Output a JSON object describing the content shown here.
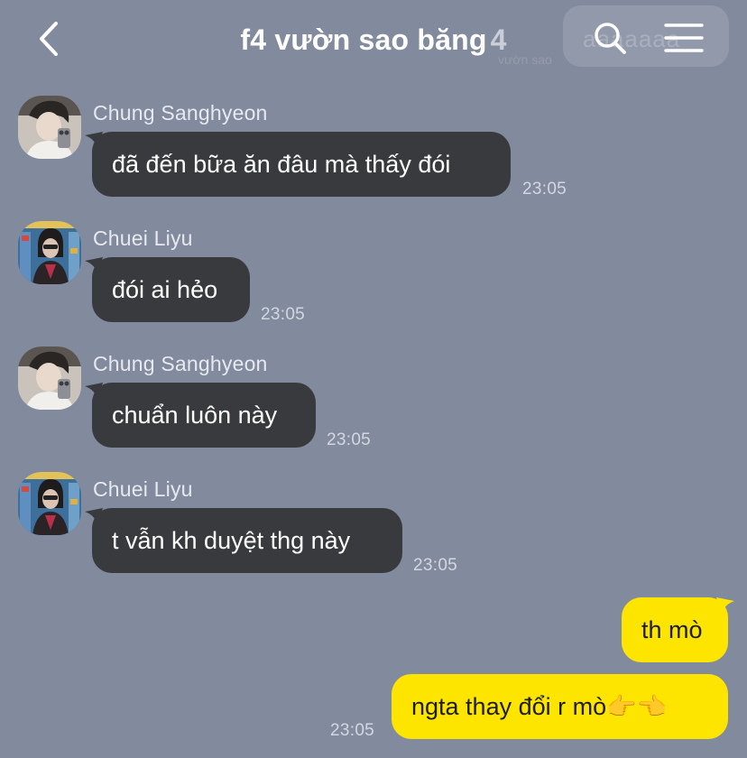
{
  "header": {
    "title": "f4 vườn sao băng",
    "member_count": "4",
    "back_icon": "chevron-left-icon",
    "search_icon": "search-icon",
    "menu_icon": "hamburger-menu-icon"
  },
  "colors": {
    "background": "#828A9D",
    "incoming_bubble": "#393A3E",
    "outgoing_bubble": "#FEE500",
    "text_light": "#FFFFFF"
  },
  "messages": [
    {
      "direction": "in",
      "sender": "Chung Sanghyeon",
      "text": "đã đến bữa ăn đâu mà thấy đói",
      "time": "23:05"
    },
    {
      "direction": "in",
      "sender": "Chuei Liyu",
      "text": "đói ai hẻo",
      "time": "23:05"
    },
    {
      "direction": "in",
      "sender": "Chung Sanghyeon",
      "text": "chuẩn luôn này",
      "time": "23:05"
    },
    {
      "direction": "in",
      "sender": "Chuei Liyu",
      "text": "t vẫn kh duyệt thg này",
      "time": "23:05"
    },
    {
      "direction": "out",
      "text": "th mò"
    },
    {
      "direction": "out",
      "text": "ngta thay đổi r mò👉👈",
      "time": "23:05"
    }
  ]
}
